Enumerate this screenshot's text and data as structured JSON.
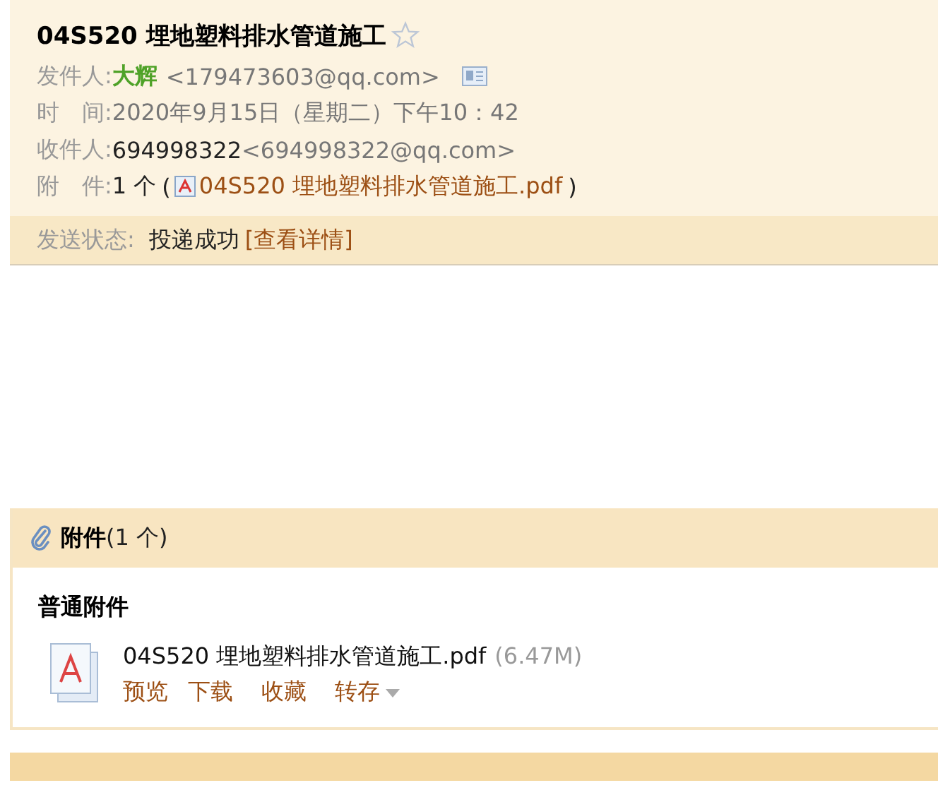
{
  "subject": {
    "title": "04S520 埋地塑料排水管道施工",
    "starred": false
  },
  "fields": [
    {
      "kind": "sender",
      "label": "发件人:",
      "name": "大辉",
      "address": "<179473603@qq.com>"
    },
    {
      "kind": "time",
      "label": "时　间:",
      "value": "2020年9月15日（星期二）下午10：42"
    },
    {
      "kind": "recipient",
      "label": "收件人:",
      "name": "694998322",
      "address": "<694998322@qq.com>"
    },
    {
      "kind": "attachment",
      "label": "附　件:",
      "count": "1 个",
      "open": "(",
      "file": "04S520 埋地塑料排水管道施工.pdf",
      "close": ")"
    }
  ],
  "status": {
    "label": "发送状态:",
    "value": "投递成功",
    "link": "[查看详情]"
  },
  "attachments": {
    "title": "附件",
    "count": "(1 个)",
    "section": "普通附件",
    "files": [
      {
        "name": "04S520 埋地塑料排水管道施工.pdf",
        "size": "(6.47M)",
        "actions": [
          "预览",
          "下载",
          "收藏",
          "转存"
        ]
      }
    ]
  }
}
